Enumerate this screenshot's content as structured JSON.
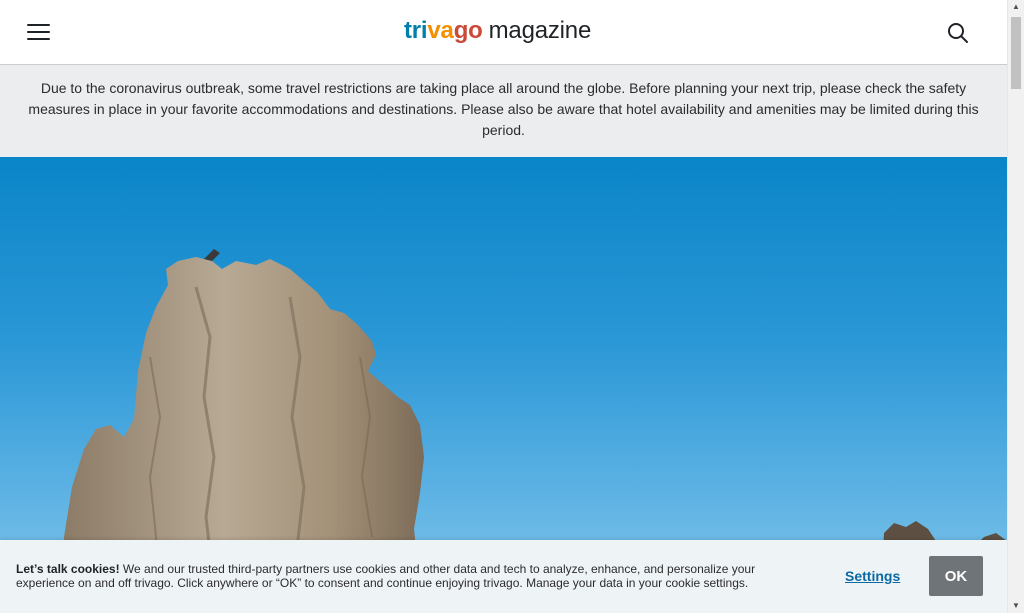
{
  "header": {
    "logo_tri": "tri",
    "logo_va": "va",
    "logo_go": "go",
    "logo_magazine": "magazine",
    "menu_icon": "hamburger-menu-icon",
    "search_icon": "search-icon"
  },
  "notice": {
    "text": "Due to the coronavirus outbreak, some travel restrictions are taking place all around the globe. Before planning your next trip, please check the safety measures in place in your favorite accommodations and destinations. Please also be aware that hotel availability and amenities may be limited during this period."
  },
  "hero": {
    "image": "rock-tufa-blue-sky-photo"
  },
  "cookie_banner": {
    "heading": "Let’s talk cookies!",
    "body": " We and our trusted third-party partners use cookies and other data and tech to analyze, enhance, and personalize your experience on and off trivago. Click anywhere or “OK” to consent and continue enjoying trivago. Manage your data in your cookie settings.",
    "settings_label": "Settings",
    "ok_label": "OK"
  },
  "scrollbar": {
    "up_arrow": "▲",
    "down_arrow": "▼"
  },
  "colors": {
    "brand_blue": "#007fad",
    "brand_orange": "#f48f00",
    "brand_red": "#c94a38",
    "notice_bg": "#ebedee",
    "ok_button": "#6e7478"
  }
}
